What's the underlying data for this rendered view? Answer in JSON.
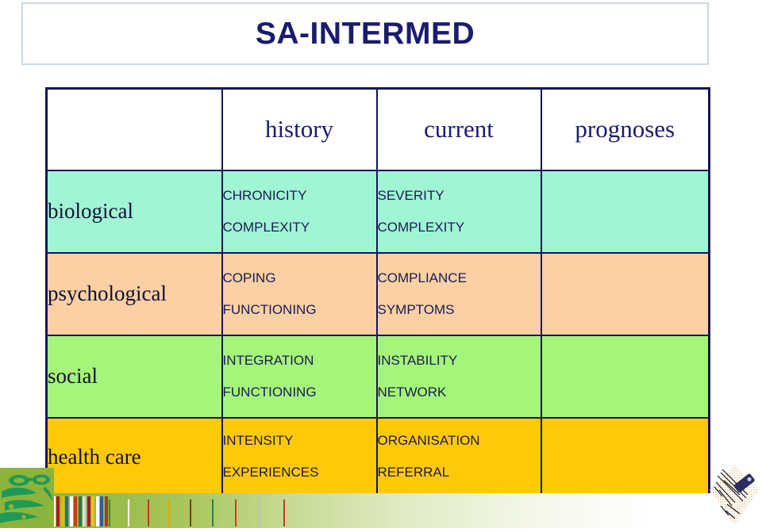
{
  "slide": {
    "title": "SA-INTERMED",
    "background_color": "#ffffff",
    "title_text_color": "#1b1b6e",
    "title_border_color": "#c8d9e6",
    "table_border_color": "#161659"
  },
  "table": {
    "corner_label": "",
    "column_headers": [
      "history",
      "current",
      "prognoses"
    ],
    "rows": [
      {
        "label": "biological",
        "row_color": "#9ff5d4",
        "history": [
          "CHRONICITY",
          "COMPLEXITY"
        ],
        "current": [
          "SEVERITY",
          "COMPLEXITY"
        ],
        "prognoses": []
      },
      {
        "label": "psychological",
        "row_color": "#fad0a4",
        "history": [
          "COPING",
          "FUNCTIONING"
        ],
        "current": [
          "COMPLIANCE",
          "SYMPTOMS"
        ],
        "prognoses": []
      },
      {
        "label": "social",
        "row_color": "#a5f57a",
        "history": [
          "INTEGRATION",
          "FUNCTIONING"
        ],
        "current": [
          "INSTABILITY",
          "NETWORK"
        ],
        "prognoses": []
      },
      {
        "label": "health care",
        "row_color": "#ffc907",
        "history": [
          "INTENSITY",
          "EXPERIENCES"
        ],
        "current": [
          "ORGANISATION",
          "REFERRAL"
        ],
        "prognoses": []
      }
    ]
  },
  "decoration": {
    "band_colors": [
      "#8cb33c",
      "#c6da92",
      "#ffffff"
    ],
    "stripe_colors": [
      "#3a7a2a",
      "#ffffff",
      "#b01a1a",
      "#e8b800",
      "#2e6b8f",
      "#ffffff",
      "#c83c12",
      "#1f7a4a",
      "#d8d8d8",
      "#a8192a",
      "#e8c020",
      "#ffffff",
      "#2a5f9e",
      "#b8341c",
      "#3f8a32",
      "#ffffff",
      "#c0392b",
      "#e0a800",
      "#7a3b12",
      "#2f7f57",
      "#c2401f",
      "#bfbfbf",
      "#c0392b"
    ],
    "left_art_name": "green-mask-graphic",
    "right_art_name": "sketch-graphic"
  }
}
